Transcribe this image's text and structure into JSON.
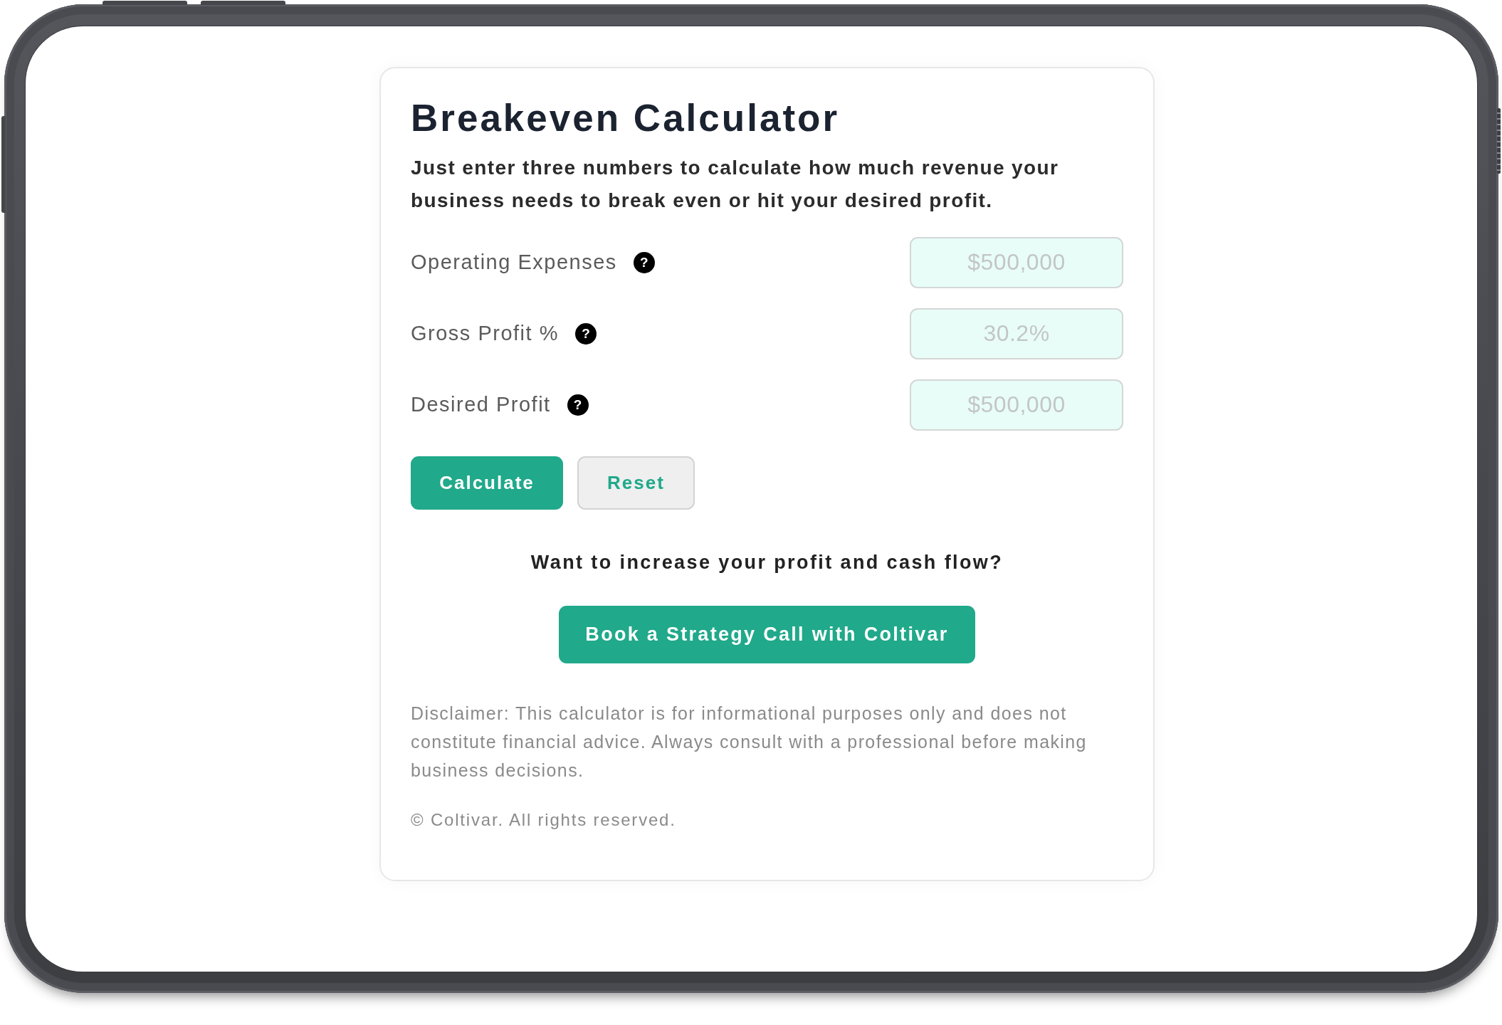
{
  "calculator": {
    "title": "Breakeven Calculator",
    "intro": "Just enter three numbers to calculate how much revenue your business needs to break even or hit your desired profit.",
    "fields": [
      {
        "label": "Operating Expenses",
        "help": "?",
        "placeholder": "$500,000"
      },
      {
        "label": "Gross Profit %",
        "help": "?",
        "placeholder": "30.2%"
      },
      {
        "label": "Desired Profit",
        "help": "?",
        "placeholder": "$500,000"
      }
    ],
    "buttons": [
      {
        "label": "Calculate",
        "kind": "primary"
      },
      {
        "label": "Reset",
        "kind": "secondary"
      }
    ],
    "cta": {
      "prompt": "Want to increase your profit and cash flow?",
      "button": "Book a Strategy Call with Coltivar"
    },
    "disclaimer": "Disclaimer: This calculator is for informational purposes only and does not constitute financial advice. Always consult with a professional before making business decisions.",
    "copyright": "© Coltivar. All rights reserved."
  }
}
